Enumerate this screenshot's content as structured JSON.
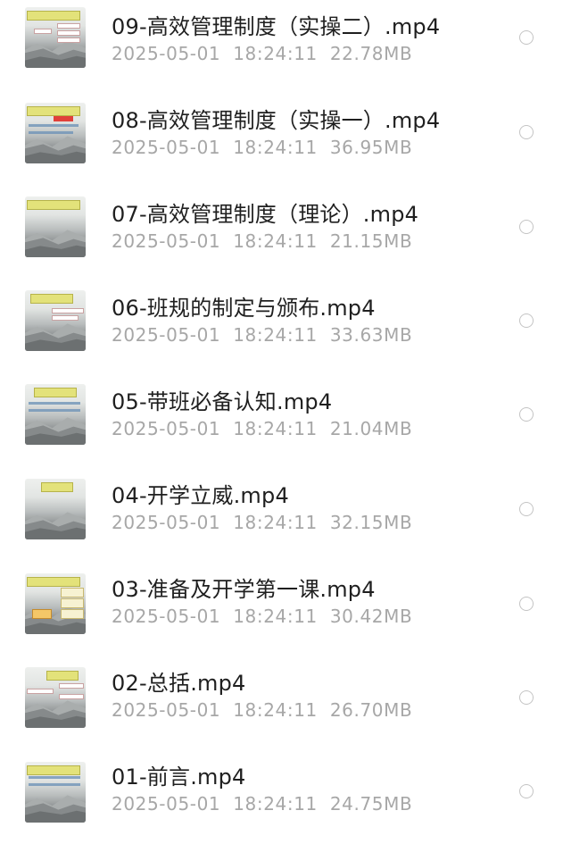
{
  "files": [
    {
      "name": "09-高效管理制度（实操二）.mp4",
      "date": "2025-05-01",
      "time": "18:24:11",
      "size": "22.78MB"
    },
    {
      "name": "08-高效管理制度（实操一）.mp4",
      "date": "2025-05-01",
      "time": "18:24:11",
      "size": "36.95MB"
    },
    {
      "name": "07-高效管理制度（理论）.mp4",
      "date": "2025-05-01",
      "time": "18:24:11",
      "size": "21.15MB"
    },
    {
      "name": "06-班规的制定与颁布.mp4",
      "date": "2025-05-01",
      "time": "18:24:11",
      "size": "33.63MB"
    },
    {
      "name": "05-带班必备认知.mp4",
      "date": "2025-05-01",
      "time": "18:24:11",
      "size": "21.04MB"
    },
    {
      "name": "04-开学立威.mp4",
      "date": "2025-05-01",
      "time": "18:24:11",
      "size": "32.15MB"
    },
    {
      "name": "03-准备及开学第一课.mp4",
      "date": "2025-05-01",
      "time": "18:24:11",
      "size": "30.42MB"
    },
    {
      "name": "02-总括.mp4",
      "date": "2025-05-01",
      "time": "18:24:11",
      "size": "26.70MB"
    },
    {
      "name": "01-前言.mp4",
      "date": "2025-05-01",
      "time": "18:24:11",
      "size": "24.75MB"
    }
  ],
  "icons": {
    "thumbnail": "video-thumbnail-icon",
    "select": "radio-unchecked-icon"
  },
  "colors": {
    "name_text": "#1f1f1f",
    "meta_text": "#a7a7a7",
    "radio_border": "#c4c4c4"
  }
}
